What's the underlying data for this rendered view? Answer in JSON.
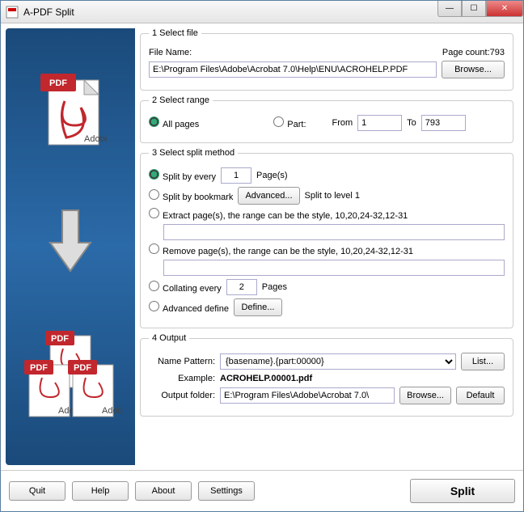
{
  "window": {
    "title": "A-PDF Split"
  },
  "section1": {
    "legend": "1 Select file",
    "file_label": "File Name:",
    "file_value": "E:\\Program Files\\Adobe\\Acrobat 7.0\\Help\\ENU\\ACROHELP.PDF",
    "pagecount_label": "Page count:",
    "pagecount_value": "793",
    "browse": "Browse..."
  },
  "section2": {
    "legend": "2 Select range",
    "all": "All pages",
    "part": "Part:",
    "from_label": "From",
    "from_value": "1",
    "to_label": "To",
    "to_value": "793"
  },
  "section3": {
    "legend": "3 Select split method",
    "split_every": "Split by every",
    "split_every_value": "1",
    "pages_label": "Page(s)",
    "by_bookmark": "Split by bookmark",
    "advanced_btn": "Advanced...",
    "split_level": "Split to level 1",
    "extract_label": "Extract page(s), the range can be the style, 10,20,24-32,12-31",
    "remove_label": "Remove page(s), the range can be the style, 10,20,24-32,12-31",
    "collating": "Collating every",
    "collating_value": "2",
    "collating_pages": "Pages",
    "adv_define": "Advanced define",
    "define_btn": "Define..."
  },
  "section4": {
    "legend": "4 Output",
    "pattern_label": "Name Pattern:",
    "pattern_value": "{basename}.{part:00000}",
    "list_btn": "List...",
    "example_label": "Example:",
    "example_value": "ACROHELP.00001.pdf",
    "output_label": "Output folder:",
    "output_value": "E:\\Program Files\\Adobe\\Acrobat 7.0\\",
    "browse": "Browse...",
    "default": "Default"
  },
  "bottom": {
    "quit": "Quit",
    "help": "Help",
    "about": "About",
    "settings": "Settings",
    "split": "Split"
  }
}
